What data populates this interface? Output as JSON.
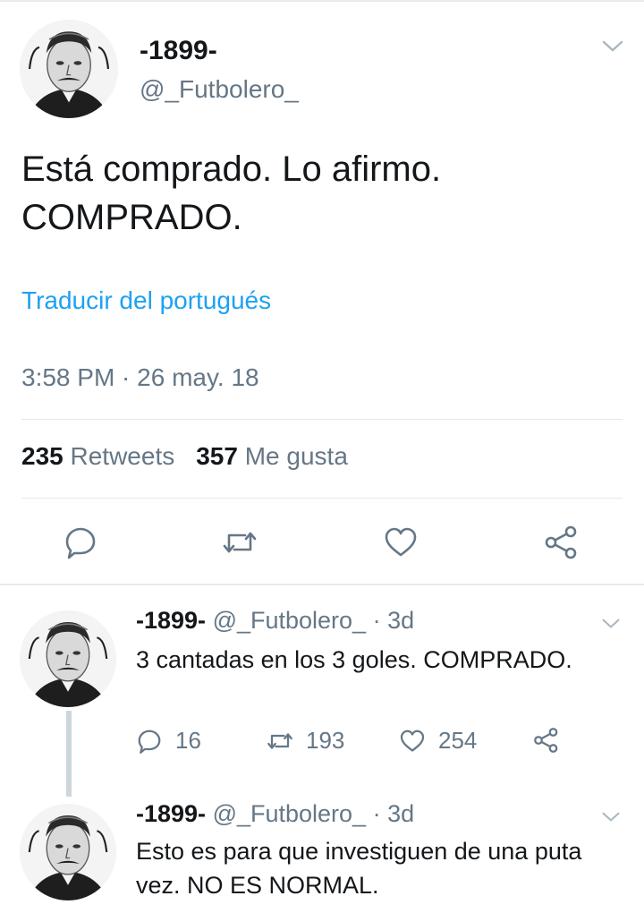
{
  "main_tweet": {
    "display_name": "-1899-",
    "handle": "@_Futbolero_",
    "text_line1": "Está comprado. Lo afirmo.",
    "text_line2": "COMPRADO.",
    "translate_link": "Traducir del portugués",
    "timestamp": "3:58 PM · 26 may. 18",
    "retweets_count": "235",
    "retweets_label": "Retweets",
    "likes_count": "357",
    "likes_label": "Me gusta",
    "actions": [
      "reply-icon",
      "retweet-icon",
      "like-icon",
      "share-icon"
    ]
  },
  "replies": [
    {
      "display_name": "-1899-",
      "handle": "@_Futbolero_",
      "age": "· 3d",
      "text": "3 cantadas en los 3 goles. COMPRADO.",
      "reply_count": "16",
      "retweet_count": "193",
      "like_count": "254"
    },
    {
      "display_name": "-1899-",
      "handle": "@_Futbolero_",
      "age": "· 3d",
      "text": "Esto es para que investiguen de una puta vez. NO ES NORMAL."
    }
  ],
  "colors": {
    "accent": "#1da1f2",
    "secondary_text": "#657786",
    "primary_text": "#14171a",
    "divider": "#e1e8ed",
    "thread_line": "#ccd6dd"
  }
}
